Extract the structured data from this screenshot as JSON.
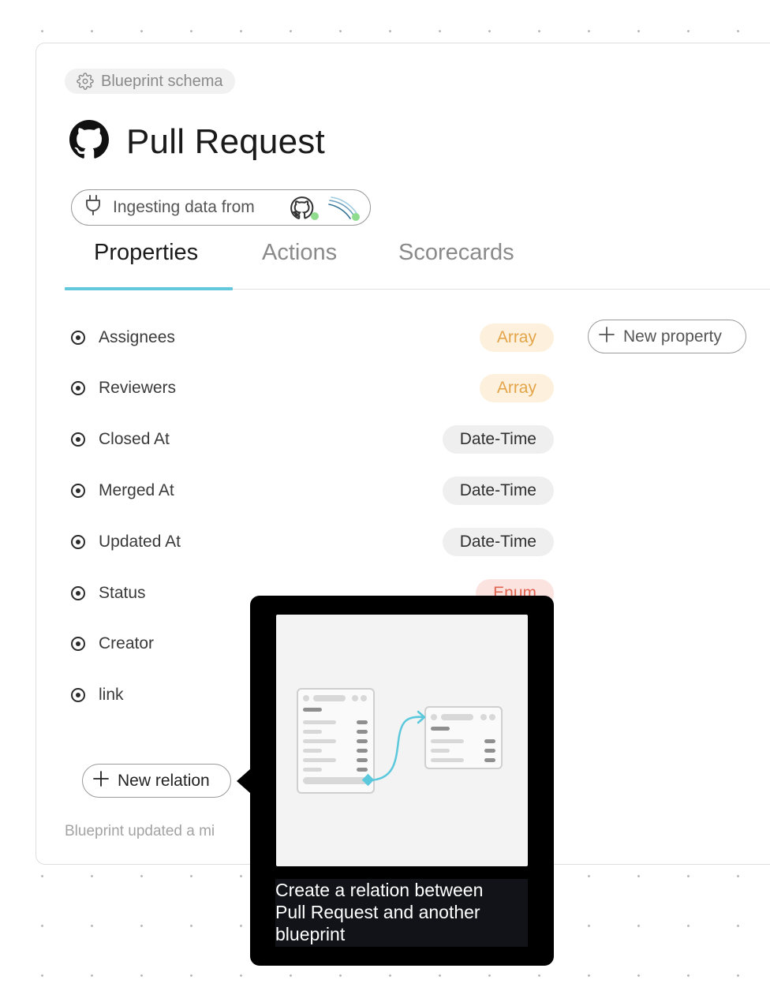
{
  "header": {
    "schema_chip_label": "Blueprint schema",
    "title": "Pull Request",
    "ingest_label": "Ingesting data from"
  },
  "tabs": [
    {
      "label": "Properties",
      "active": true
    },
    {
      "label": "Actions",
      "active": false
    },
    {
      "label": "Scorecards",
      "active": false
    }
  ],
  "properties": [
    {
      "name": "Assignees",
      "type": "Array"
    },
    {
      "name": "Reviewers",
      "type": "Array"
    },
    {
      "name": "Closed At",
      "type": "Date-Time"
    },
    {
      "name": "Merged At",
      "type": "Date-Time"
    },
    {
      "name": "Updated At",
      "type": "Date-Time"
    },
    {
      "name": "Status",
      "type": "Enum"
    },
    {
      "name": "Creator",
      "type": ""
    },
    {
      "name": "link",
      "type": ""
    }
  ],
  "buttons": {
    "new_property": "New property",
    "new_relation": "New relation"
  },
  "footer": {
    "updated_text": "Blueprint updated a mi"
  },
  "tooltip": {
    "caption_lines": [
      "Create a relation between",
      "Pull Request and another",
      "blueprint"
    ]
  },
  "colors": {
    "accent_tab": "#64c8dd",
    "array_bg": "#fdf1de",
    "array_text": "#e4a448",
    "datetime_bg": "#efefef",
    "enum_bg": "#fbe4e0",
    "enum_text": "#e26551",
    "relation_line": "#5bc8dc"
  },
  "icons": {
    "schema": "gear-icon",
    "title": "github-icon",
    "ingest": "plug-icon",
    "add": "plus-icon",
    "property": "radio-dot-icon"
  }
}
